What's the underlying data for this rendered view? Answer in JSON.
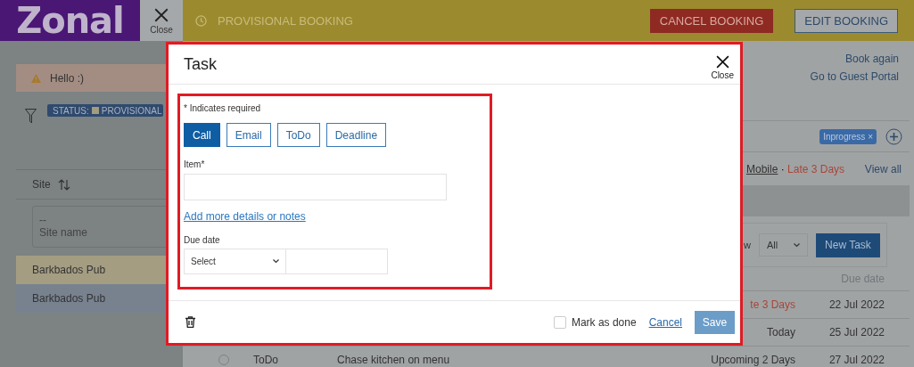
{
  "header": {
    "logo": "Zonal",
    "close_label": "Close",
    "booking_status": "PROVISIONAL BOOKING",
    "actions": [
      {
        "label": "CANCEL BOOKING",
        "kind": "danger"
      },
      {
        "label": "EDIT BOOKING",
        "kind": "outline"
      }
    ]
  },
  "sidebar": {
    "alert": "Hello :)",
    "status_filter": {
      "label": "STATUS:",
      "value": "PROVISIONAL"
    },
    "site_column": "Site",
    "site_filter": {
      "value": "--",
      "label": "Site name"
    },
    "rows": [
      {
        "name": "Barkbados Pub",
        "color": "#a49d82"
      },
      {
        "name": "Barkbados Pub",
        "color": "#78828f"
      }
    ]
  },
  "booking_panel": {
    "links": [
      "Book again",
      "Go to Guest Portal"
    ],
    "tags": [
      {
        "label": "Inprogress",
        "remove": "×"
      }
    ],
    "summary": {
      "channel": "Mobile",
      "separator": "·",
      "due": "Late 3 Days",
      "view_all": "View all"
    },
    "tasks": {
      "filter_label": "w",
      "filter_value": "All",
      "new_button": "New Task",
      "due_column": "Due date",
      "rows": [
        {
          "status": "te 3 Days",
          "late": true,
          "due": "22 Jul 2022"
        },
        {
          "status": "Today",
          "late": false,
          "due": "25 Jul 2022"
        },
        {
          "type": "ToDo",
          "checked": false,
          "item": "Chase kitchen on menu",
          "status": "Upcoming 2 Days",
          "late": false,
          "due": "27 Jul 2022"
        }
      ]
    }
  },
  "dialog": {
    "title": "Task",
    "close_label": "Close",
    "required_note": "* Indicates required",
    "task_types": [
      {
        "label": "Call",
        "selected": true
      },
      {
        "label": "Email",
        "selected": false
      },
      {
        "label": "ToDo",
        "selected": false
      },
      {
        "label": "Deadline",
        "selected": false
      }
    ],
    "item_label": "Item*",
    "details_link": "Add more details or notes",
    "due_label": "Due date",
    "due_select": "Select",
    "mark_done": {
      "label": "Mark as done",
      "checked": false
    },
    "cancel": "Cancel",
    "save": {
      "label": "Save",
      "disabled": true
    }
  }
}
